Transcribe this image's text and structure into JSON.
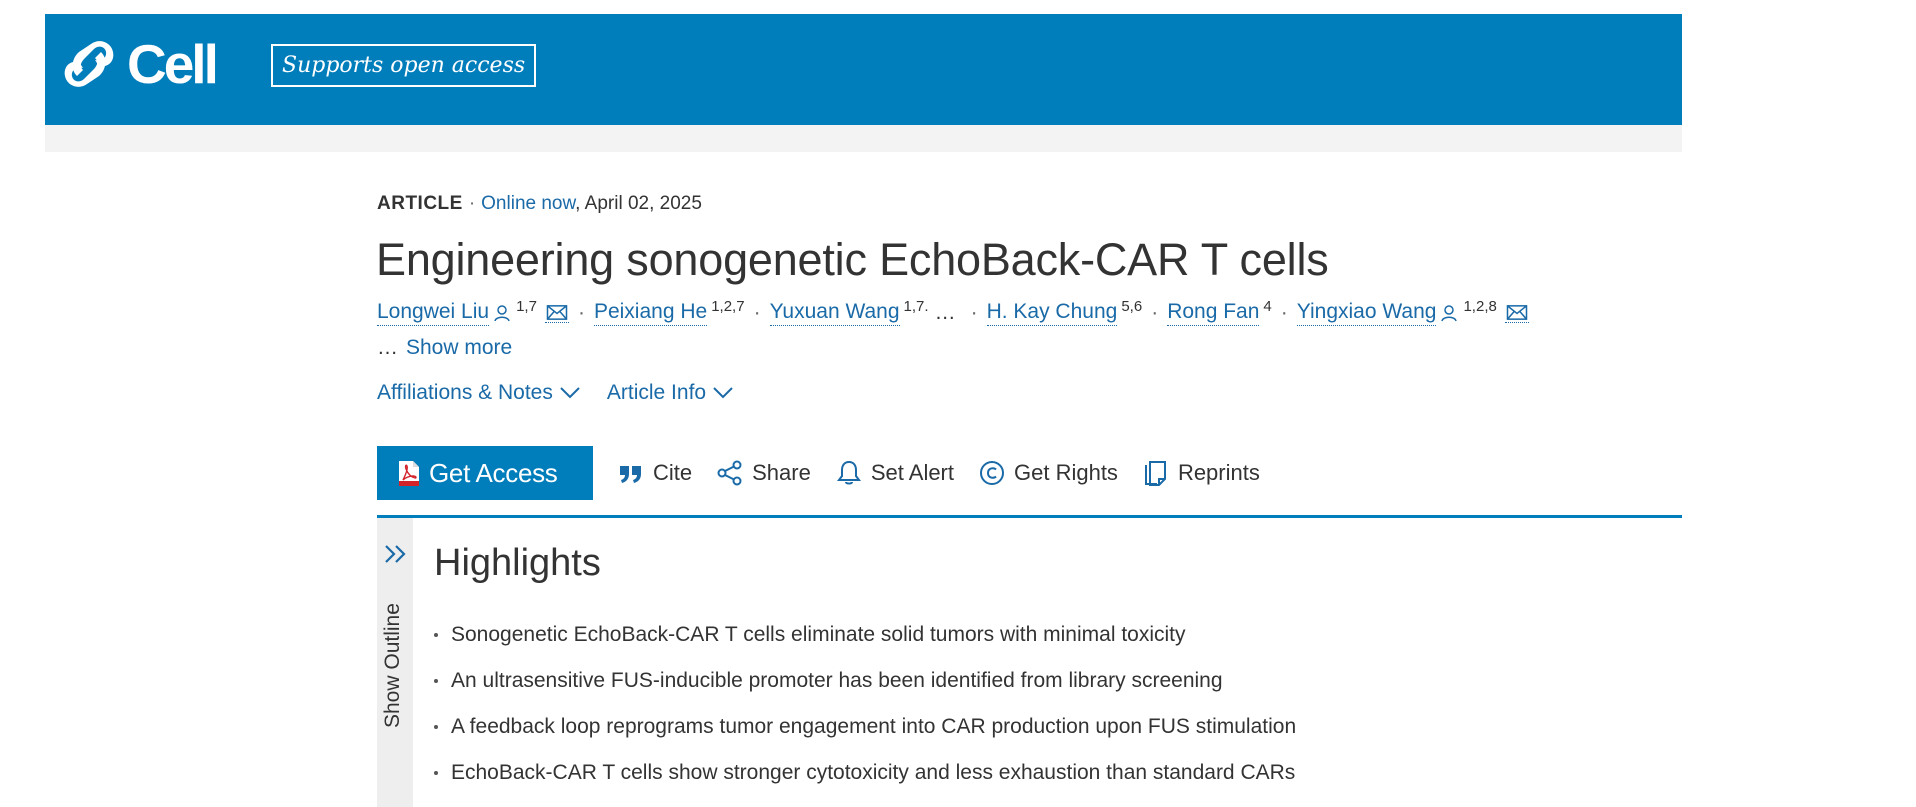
{
  "header": {
    "logo_text": "Cell",
    "open_access_badge": "Supports open access",
    "brand_color": "#007dbb"
  },
  "article_meta": {
    "type": "ARTICLE",
    "online_label": "Online now",
    "date": ", April 02, 2025"
  },
  "title": "Engineering sonogenetic EchoBack-CAR T cells",
  "authors": [
    {
      "name": "Longwei Liu",
      "sup": "1,7",
      "person_icon": true,
      "mail_icon": true
    },
    {
      "name": "Peixiang He",
      "sup": "1,2,7"
    },
    {
      "name": "Yuxuan Wang",
      "sup": "1,7."
    },
    {
      "name": "H. Kay Chung",
      "sup": "5,6"
    },
    {
      "name": "Rong Fan",
      "sup": "4"
    },
    {
      "name": "Yingxiao Wang",
      "sup": "1,2,8",
      "person_icon": true,
      "mail_icon": true
    }
  ],
  "authors_ellipsis": "…",
  "show_more": {
    "dots": "…",
    "label": "Show more"
  },
  "info_links": {
    "affiliations": "Affiliations & Notes",
    "article_info": "Article Info"
  },
  "toolbar": {
    "get_access": "Get Access",
    "cite": "Cite",
    "share": "Share",
    "set_alert": "Set Alert",
    "get_rights": "Get Rights",
    "reprints": "Reprints",
    "icons": [
      "pdf-icon",
      "quote-icon",
      "share-icon",
      "bell-icon",
      "copyright-icon",
      "document-icon"
    ]
  },
  "outline": {
    "label": "Show Outline",
    "icon": "double-chevron-right-icon"
  },
  "highlights": {
    "title": "Highlights",
    "items": [
      "Sonogenetic EchoBack-CAR T cells eliminate solid tumors with minimal toxicity",
      "An ultrasensitive FUS-inducible promoter has been identified from library screening",
      "A feedback loop reprograms tumor engagement into CAR production upon FUS stimulation",
      "EchoBack-CAR T cells show stronger cytotoxicity and less exhaustion than standard CARs"
    ]
  }
}
